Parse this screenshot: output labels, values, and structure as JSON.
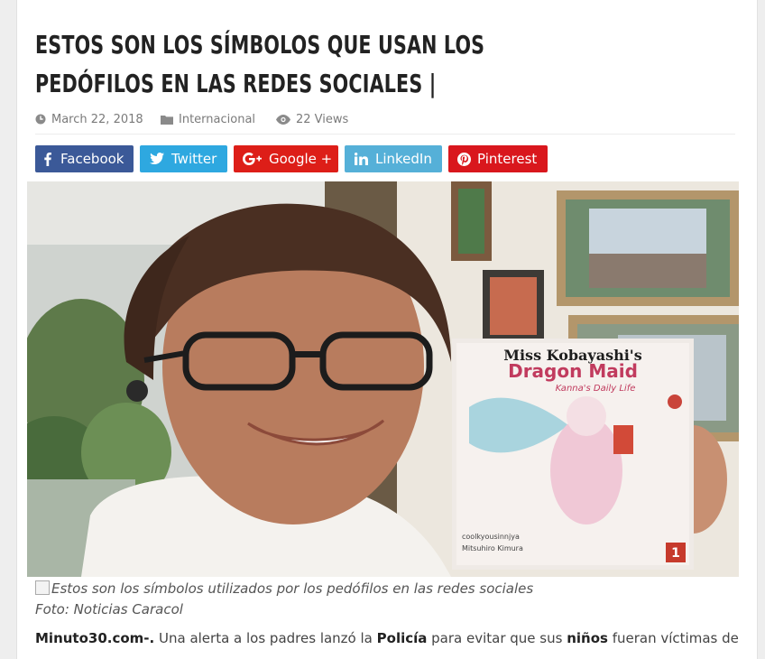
{
  "article": {
    "title": "Estos son los símbolos que usan los pedófilos en las redes sociales |",
    "meta": {
      "date": "March 22, 2018",
      "category": "Internacional",
      "views": "22 Views"
    }
  },
  "share_buttons": [
    {
      "label": "Facebook",
      "color": "#3b5998",
      "icon": "facebook-icon"
    },
    {
      "label": "Twitter",
      "color": "#2ea8e0",
      "icon": "twitter-icon"
    },
    {
      "label": "Google +",
      "color": "#dd1e18",
      "icon": "google-plus-icon"
    },
    {
      "label": "LinkedIn",
      "color": "#55b0d8",
      "icon": "linkedin-icon"
    },
    {
      "label": "Pinterest",
      "color": "#d9171d",
      "icon": "pinterest-icon"
    }
  ],
  "hero_image": {
    "book": {
      "title_line1": "Miss Kobayashi's",
      "title_line2": "Dragon Maid",
      "subtitle": "Kanna's Daily Life",
      "author": "coolkyousinnjya",
      "artist": "Mitsuhiro Kimura",
      "volume": "1"
    }
  },
  "caption": {
    "alt_text": "Estos son los símbolos utilizados por los pedófilos en las redes sociales",
    "credit": "Foto: Noticias Caracol"
  },
  "body": {
    "source": "Minuto30.com-.",
    "seg1": " Una alerta a los padres lanzó la ",
    "bold1": "Policía",
    "seg2": " para evitar que sus ",
    "bold2": "niños",
    "seg3": " fueran víctimas de"
  }
}
